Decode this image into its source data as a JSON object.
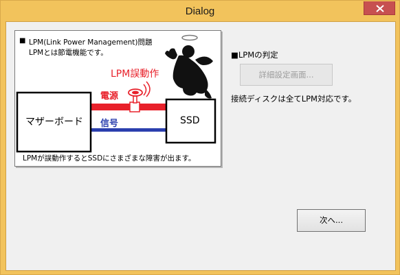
{
  "window": {
    "title": "Dialog",
    "close_glyph": "×"
  },
  "figure": {
    "heading_bullet": "■",
    "heading_line1": "LPM(Link Power Management)問題",
    "heading_line2": "LPMとは節電機能です。",
    "malfunction_label": "LPM誤動作",
    "power_label": "電源",
    "signal_label": "信号",
    "motherboard_label": "マザーボード",
    "ssd_label": "SSD",
    "caption": "LPMが誤動作するとSSDにさまざまな障害が出ます。",
    "icons": [
      "angel-icon",
      "halo-icon",
      "faucet-valve-icon"
    ],
    "colors": {
      "power_line": "#e8202a",
      "signal_line": "#2b3fae",
      "text_red": "#e8202a",
      "text_blue": "#2b3fae"
    }
  },
  "right_panel": {
    "lpm_heading": "■LPMの判定",
    "detail_button_label": "詳細設定画面...",
    "detail_button_enabled": false,
    "status_text": "接続ディスクは全てLPM対応です。"
  },
  "footer": {
    "next_button_label": "次へ..."
  },
  "theme": {
    "frame_color": "#f2c35c",
    "client_bg": "#f0f0f0",
    "close_button_color": "#c75050"
  }
}
